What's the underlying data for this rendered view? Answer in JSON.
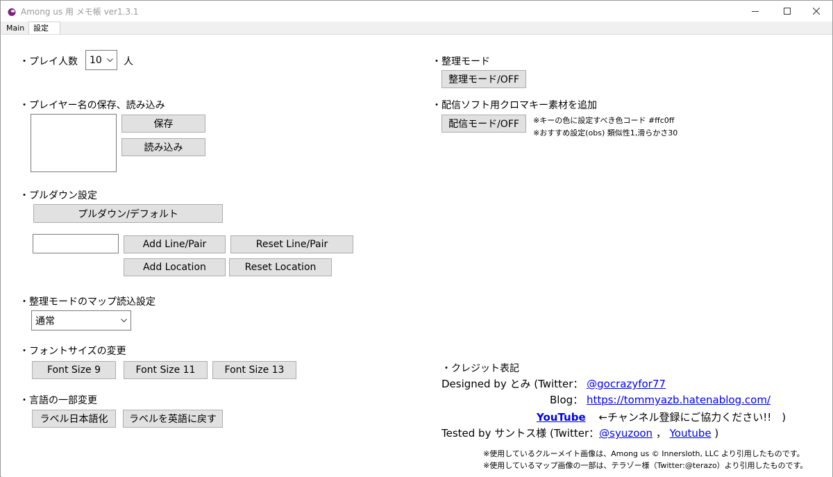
{
  "window": {
    "title": "Among us 用 メモ帳 ver1.3.1"
  },
  "tabs": [
    {
      "label": "Main"
    },
    {
      "label": "設定"
    }
  ],
  "players": {
    "label": "・プレイ人数",
    "value": "10",
    "unit": "人"
  },
  "player_names": {
    "label": "・プレイヤー名の保存、読み込み",
    "save_button": "保存",
    "load_button": "読み込み"
  },
  "pulldown": {
    "label": "・プルダウン設定",
    "default_button": "プルダウン/デフォルト",
    "add_line_pair": "Add Line/Pair",
    "reset_line_pair": "Reset Line/Pair",
    "add_location": "Add Location",
    "reset_location": "Reset Location"
  },
  "map_load": {
    "label": "・整理モードのマップ読込設定",
    "value": "通常"
  },
  "font_size": {
    "label": "・フォントサイズの変更",
    "buttons": [
      "Font Size 9",
      "Font Size 11",
      "Font Size 13"
    ]
  },
  "language": {
    "label": "・言語の一部変更",
    "japanese_button": "ラベル日本語化",
    "english_button": "ラベルを英語に戻す"
  },
  "organize_mode": {
    "label": "・整理モード",
    "button": "整理モード/OFF"
  },
  "chroma": {
    "label": "・配信ソフト用クロマキー素材を追加",
    "button": "配信モード/OFF",
    "note1": "※キーの色に設定すべき色コード #ffc0ff",
    "note2": "※おすすめ設定(obs) 類似性1,滑らかさ30"
  },
  "credits": {
    "label": "・クレジット表記",
    "designed_prefix": "Designed by とみ (Twitter：",
    "designed_link": "@gocrazyfor77",
    "blog_prefix": "Blog：",
    "blog_link": "https://tommyazb.hatenablog.com/",
    "youtube_link": "YouTube",
    "youtube_text": "←チャンネル登録にご協力ください!!　)",
    "tested_prefix": "Tested by サントス様 (Twitter：",
    "tested_link1": "@syuzoon",
    "tested_sep": "，",
    "tested_link2": "Youtube",
    "tested_suffix": ")"
  },
  "footer": {
    "line1": "※使用しているクルーメイト画像は、Among us © Innersloth, LLC より引用したものです。",
    "line2": "※使用しているマップ画像の一部は、テラゾー様（Twitter:@terazo）より引用したものです。"
  },
  "colors": {
    "button_bg": "#e1e1e1",
    "link": "#0000ee",
    "app_icon": "#8b1e8b"
  }
}
